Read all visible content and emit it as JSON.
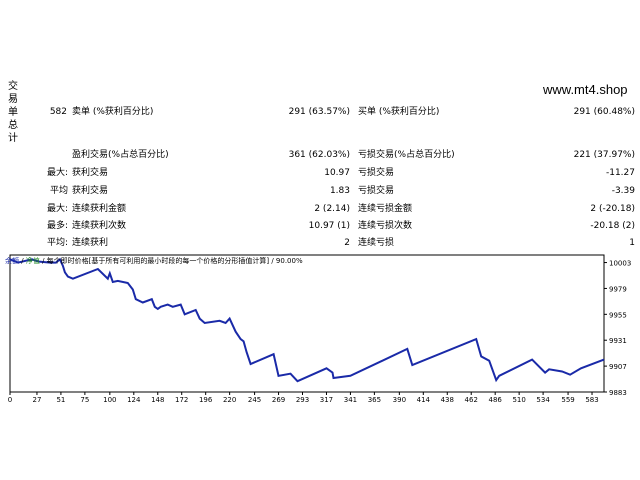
{
  "watermark": "www.mt4.shop",
  "side_chars": [
    "交",
    "易",
    "单",
    "总",
    "计"
  ],
  "stats": {
    "row1": {
      "total": "582",
      "short_label": "卖单 (%获利百分比)",
      "short_value": "291 (63.57%)",
      "long_label": "买单 (%获利百分比)",
      "long_value": "291 (60.48%)"
    },
    "row2": {
      "profit_label": "盈利交易(%占总百分比)",
      "profit_value": "361 (62.03%)",
      "loss_label": "亏损交易(%占总百分比)",
      "loss_value": "221 (37.97%)"
    },
    "row3": {
      "prefix": "最大:",
      "profit_label": "获利交易",
      "profit_value": "10.97",
      "loss_label": "亏损交易",
      "loss_value": "-11.27"
    },
    "row4": {
      "prefix": "平均",
      "profit_label": "获利交易",
      "profit_value": "1.83",
      "loss_label": "亏损交易",
      "loss_value": "-3.39"
    },
    "row5": {
      "prefix": "最大:",
      "profit_label": "连续获利金额",
      "profit_value": "2 (2.14)",
      "loss_label": "连续亏损金额",
      "loss_value": "2 (-20.18)"
    },
    "row6": {
      "prefix": "最多:",
      "profit_label": "连续获利次数",
      "profit_value": "10.97 (1)",
      "loss_label": "连续亏损次数",
      "loss_value": "-20.18 (2)"
    },
    "row7": {
      "prefix": "平均:",
      "profit_label": "连续获利",
      "profit_value": "2",
      "loss_label": "连续亏损",
      "loss_value": "1"
    }
  },
  "legend": {
    "balance": "余额",
    "sep": "/",
    "equity": "净值",
    "rest": "/ 每个即时价格[基于所有可利用的最小时段的每一个价格的分形插值计算] / 90.00%"
  },
  "chart_data": {
    "type": "line",
    "title": "",
    "xlabel": "",
    "ylabel": "",
    "x_ticks": [
      "0",
      "27",
      "51",
      "75",
      "100",
      "124",
      "148",
      "172",
      "196",
      "220",
      "245",
      "269",
      "293",
      "317",
      "341",
      "365",
      "390",
      "414",
      "438",
      "462",
      "486",
      "510",
      "534",
      "559",
      "583"
    ],
    "y_ticks": [
      "10003",
      "9979",
      "9955",
      "9931",
      "9907",
      "9883"
    ],
    "ylim": [
      9883,
      10010
    ],
    "xlim": [
      0,
      595
    ],
    "grid": false,
    "series": [
      {
        "color": "#1a2aa8",
        "x": [
          0,
          8,
          8,
          22,
          22,
          28,
          28,
          40,
          40,
          46,
          46,
          50,
          50,
          53,
          53,
          55,
          55,
          58,
          58,
          63,
          63,
          88,
          88,
          98,
          98,
          100,
          100,
          103,
          103,
          108,
          108,
          118,
          118,
          123,
          123,
          126,
          126,
          133,
          133,
          142,
          142,
          145,
          145,
          148,
          148,
          151,
          151,
          158,
          158,
          163,
          163,
          171,
          171,
          175,
          175,
          186,
          186,
          190,
          190,
          195,
          195,
          210,
          210,
          216,
          216,
          220,
          220,
          226,
          226,
          231,
          231,
          234,
          234,
          237,
          237,
          241,
          241,
          264,
          264,
          269,
          269,
          281,
          281,
          288,
          288,
          317,
          317,
          323,
          323,
          324,
          324,
          341,
          341,
          398,
          398,
          403,
          403,
          467,
          467,
          472,
          472,
          480,
          480,
          487,
          487,
          490,
          490,
          523,
          523,
          536,
          536,
          540,
          540,
          553,
          553,
          561,
          561,
          572,
          572,
          595
        ],
        "y": [
          10006,
          10003,
          10003,
          10006,
          10006,
          10004,
          10004,
          10003,
          10003,
          10003,
          10003,
          10006,
          10006,
          10000,
          10000,
          9994,
          9994,
          9990,
          9990,
          9988,
          9988,
          9997,
          9997,
          9988,
          9988,
          9993,
          9993,
          9985,
          9985,
          9986,
          9986,
          9984,
          9984,
          9978,
          9978,
          9969,
          9969,
          9966,
          9966,
          9969,
          9969,
          9962,
          9962,
          9960,
          9960,
          9962,
          9962,
          9964,
          9964,
          9962,
          9962,
          9964,
          9964,
          9955,
          9955,
          9959,
          9959,
          9951,
          9951,
          9947,
          9947,
          9949,
          9949,
          9947,
          9947,
          9951,
          9951,
          9939,
          9939,
          9932,
          9932,
          9930,
          9930,
          9920,
          9920,
          9909,
          9909,
          9918,
          9918,
          9898,
          9898,
          9900,
          9900,
          9893,
          9893,
          9905,
          9905,
          9901,
          9901,
          9896,
          9896,
          9898,
          9898,
          9923,
          9923,
          9908,
          9908,
          9932,
          9932,
          9916,
          9916,
          9912,
          9912,
          9894,
          9894,
          9898,
          9898,
          9913,
          9913,
          9901,
          9901,
          9904,
          9904,
          9902,
          9902,
          9899,
          9899,
          9905,
          9905,
          9913
        ]
      }
    ]
  }
}
